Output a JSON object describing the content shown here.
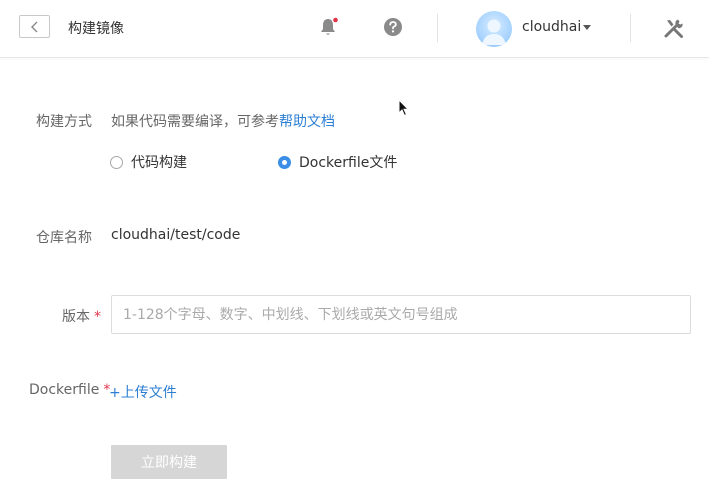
{
  "header": {
    "title": "构建镜像",
    "username": "cloudhai",
    "icons": {
      "back": "back-arrow-icon",
      "bell": "bell-icon",
      "help": "question-icon",
      "avatar": "user-avatar",
      "caret": "caret-down-icon",
      "tools": "tools-icon"
    },
    "notification_dot_color": "#e0364c"
  },
  "form": {
    "build_method": {
      "label": "构建方式",
      "hint": "如果代码需要编译，可参考",
      "help_link": "帮助文档",
      "options": [
        {
          "label": "代码构建",
          "selected": false
        },
        {
          "label": "Dockerfile文件",
          "selected": true
        }
      ]
    },
    "repo": {
      "label": "仓库名称",
      "value": "cloudhai/test/code"
    },
    "version": {
      "label": "版本",
      "required_mark": "*",
      "value": "",
      "placeholder": "1-128个字母、数字、中划线、下划线或英文句号组成"
    },
    "dockerfile": {
      "label": "Dockerfile",
      "required_mark": "*",
      "upload_label": "+上传文件"
    },
    "submit_label": "立即构建"
  },
  "colors": {
    "accent": "#2d7fd3",
    "radio_checked": "#3a8ee6",
    "required": "#e0364c",
    "disabled_button": "#d6d6d6"
  }
}
